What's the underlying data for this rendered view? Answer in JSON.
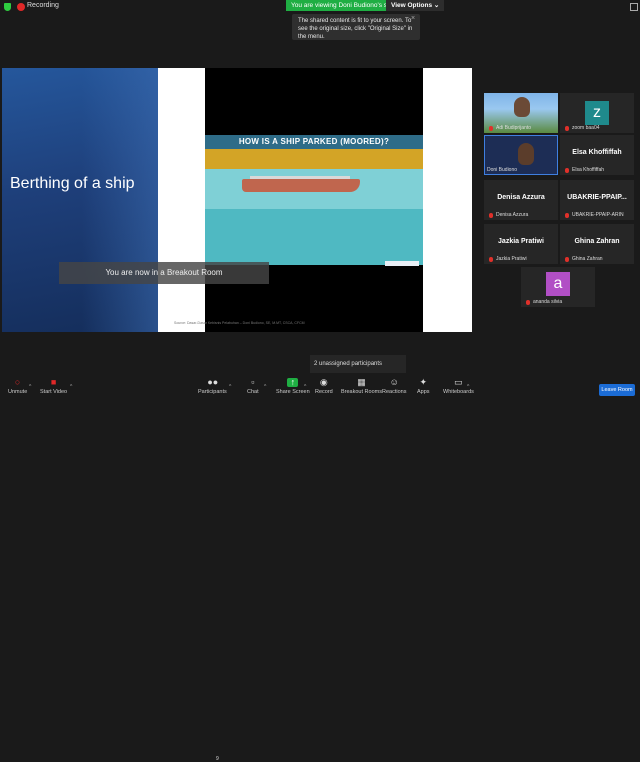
{
  "top_bar": {
    "recording_label": "Recording",
    "viewing_banner": "You are viewing Doni Budiono's screen",
    "view_options_label": "View Options",
    "view_options_caret": "⌄"
  },
  "tooltip": {
    "text": "The shared content is fit to your screen. To see the original size, click \"Original Size\" in the menu.",
    "close": "×"
  },
  "slide": {
    "title": "Berthing of a ship",
    "video_title": "HOW IS A SHIP PARKED (MOORED)?",
    "source_caption": "Source: Dasar-Dasar Kebisnis Pelabuhan – Doni Budiono, SE, M.MT, CSCA, CFCM"
  },
  "breakout_notice": "You are now in a Breakout Room",
  "participants": [
    {
      "name": "Adi Budiprijanto",
      "kind": "video"
    },
    {
      "name": "zoom baa04",
      "kind": "avatar",
      "initial": "z",
      "color": "#1f8a8c"
    },
    {
      "name": "Doni Budiono",
      "kind": "video"
    },
    {
      "name": "Elsa Khoffiffah",
      "kind": "text",
      "display": "Elsa Khoffiffah"
    },
    {
      "name": "Denisa Azzura",
      "kind": "text",
      "display": "Denisa Azzura"
    },
    {
      "name": "UBAKRIE-PPAIP-ARIN",
      "kind": "text",
      "display": "UBAKRIE-PPAIP..."
    },
    {
      "name": "Jazkia Pratiwi",
      "kind": "text",
      "display": "Jazkia Pratiwi"
    },
    {
      "name": "Ghina Zahran",
      "kind": "text",
      "display": "Ghina Zahran"
    },
    {
      "name": "ananda silvia",
      "kind": "avatar",
      "initial": "a",
      "color": "#b14fc5"
    }
  ],
  "unassigned": "2 unassigned participants",
  "toolbar": {
    "unmute": "Unmute",
    "start_video": "Start Video",
    "participants": "Participants",
    "participants_count": "9",
    "chat": "Chat",
    "share_screen": "Share Screen",
    "record": "Record",
    "breakout_rooms": "Breakout Rooms",
    "reactions": "Reactions",
    "apps": "Apps",
    "whiteboards": "Whiteboards",
    "leave_room": "Leave Room"
  },
  "colors": {
    "share_green": "#1fae43",
    "leave_blue": "#1b6cd6",
    "record_red": "#e02828"
  }
}
